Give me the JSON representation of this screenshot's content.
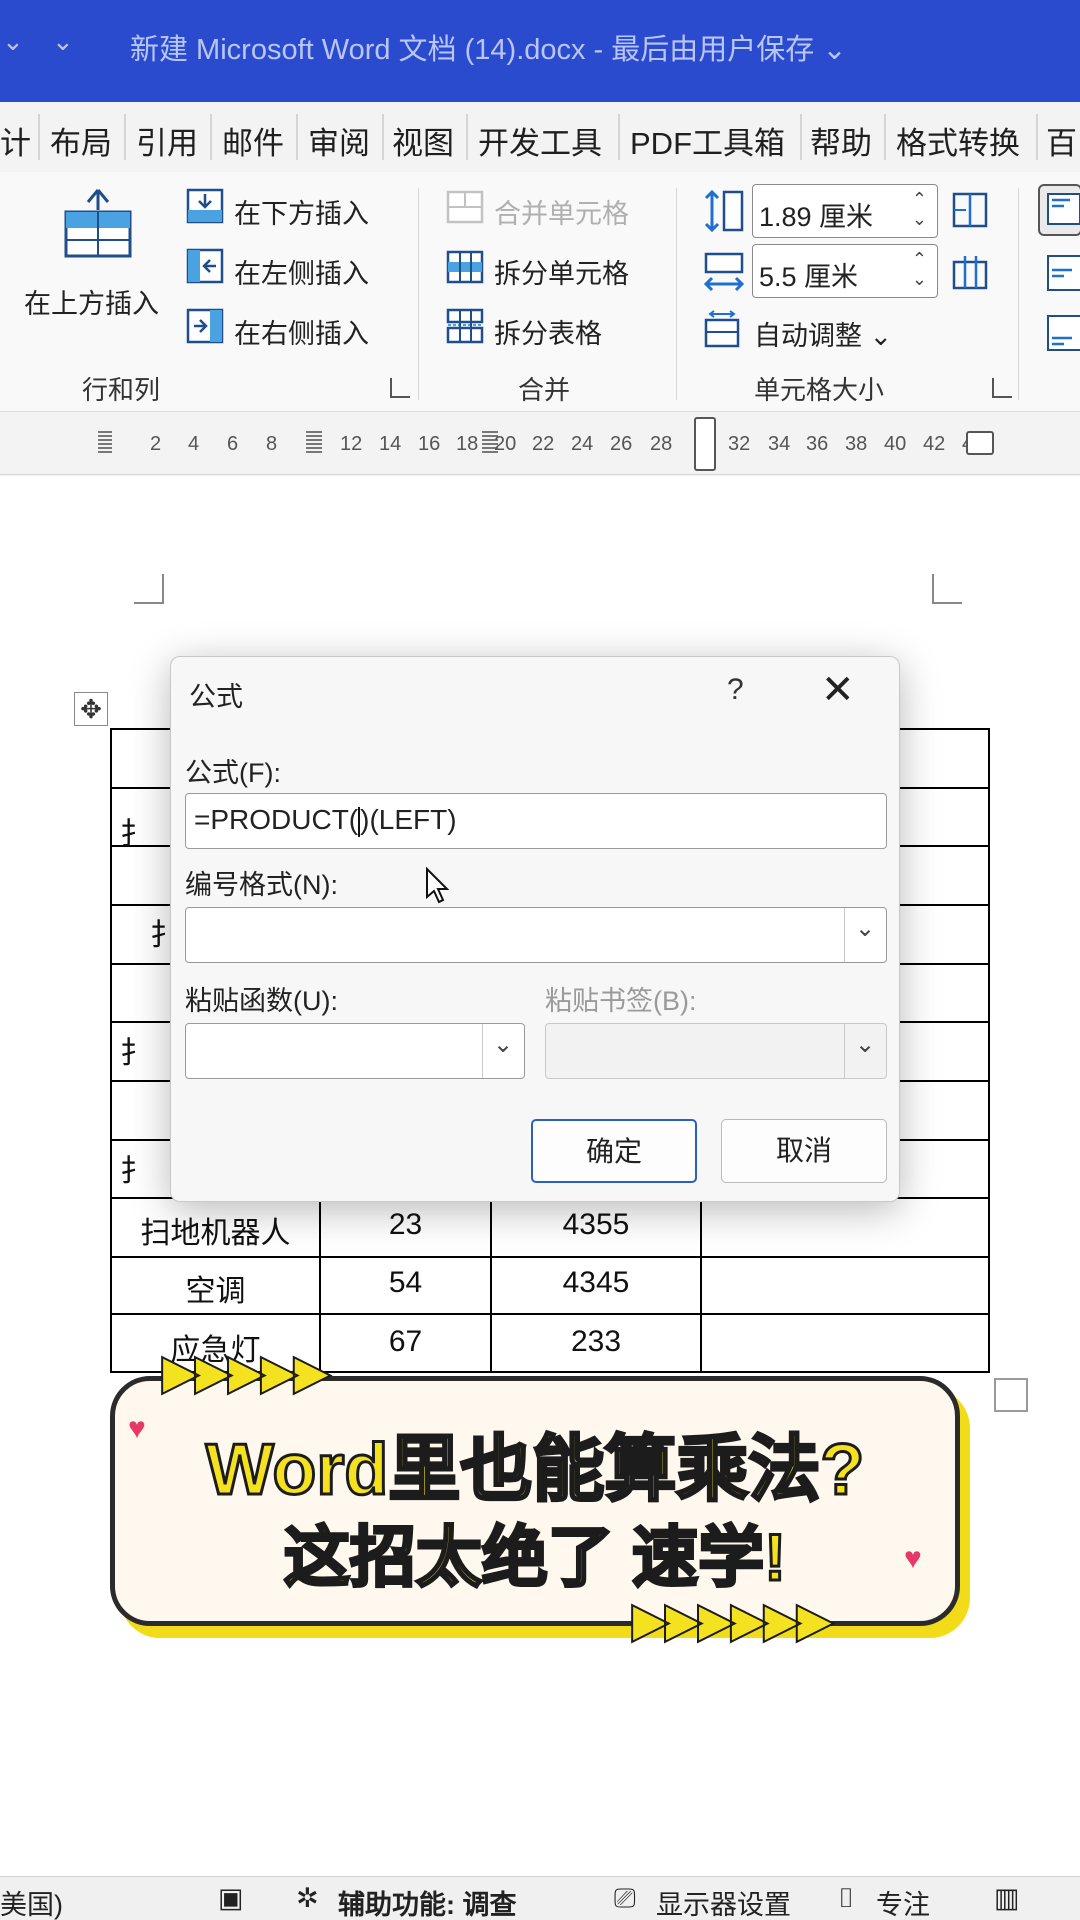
{
  "window": {
    "qa_dropdown": "⌄",
    "qa_customize": "⌄",
    "title": "新建 Microsoft Word 文档 (14).docx  -  最后由用户保存 ⌄"
  },
  "tabs": [
    "计",
    "布局",
    "引用",
    "邮件",
    "审阅",
    "视图",
    "开发工具",
    "PDF工具箱",
    "帮助",
    "格式转换",
    "百"
  ],
  "ribbon": {
    "rows_cols": {
      "insert_above": "在上方插入",
      "insert_below": "在下方插入",
      "insert_left": "在左侧插入",
      "insert_right": "在右侧插入",
      "group_label": "行和列"
    },
    "merge": {
      "merge_cells": "合并单元格",
      "split_cells": "拆分单元格",
      "split_table": "拆分表格",
      "group_label": "合并"
    },
    "cell_size": {
      "height_value": "1.89 厘米",
      "width_value": "5.5 厘米",
      "autofit": "自动调整 ⌄",
      "group_label": "单元格大小"
    }
  },
  "ruler": [
    "2",
    "4",
    "6",
    "8",
    "12",
    "14",
    "16",
    "18",
    "20",
    "22",
    "24",
    "26",
    "28",
    "32",
    "34",
    "36",
    "38",
    "40",
    "42",
    "4"
  ],
  "table": {
    "visible_rows": [
      [
        "扫地机器人",
        "23",
        "4355",
        ""
      ],
      [
        "空调",
        "54",
        "4345",
        ""
      ],
      [
        "应急灯",
        "67",
        "233",
        ""
      ]
    ],
    "partial_left_chars": [
      "扌",
      "扌",
      "扌",
      "扌"
    ]
  },
  "dialog": {
    "title": "公式",
    "help": "?",
    "close": "✕",
    "formula_label": "公式(F):",
    "formula_value_before": "=PRODUCT(",
    "formula_value_after": ")(LEFT)",
    "number_format_label": "编号格式(N):",
    "number_format_value": "",
    "paste_function_label": "粘贴函数(U):",
    "paste_bookmark_label": "粘贴书签(B):",
    "ok": "确定",
    "cancel": "取消"
  },
  "banner": {
    "line1": "Word里也能算乘法?",
    "line2": "这招太绝了 速学!"
  },
  "status": {
    "language": "美国)",
    "accessibility": "辅助功能: 调查",
    "display": "显示器设置",
    "focus": "专注"
  }
}
